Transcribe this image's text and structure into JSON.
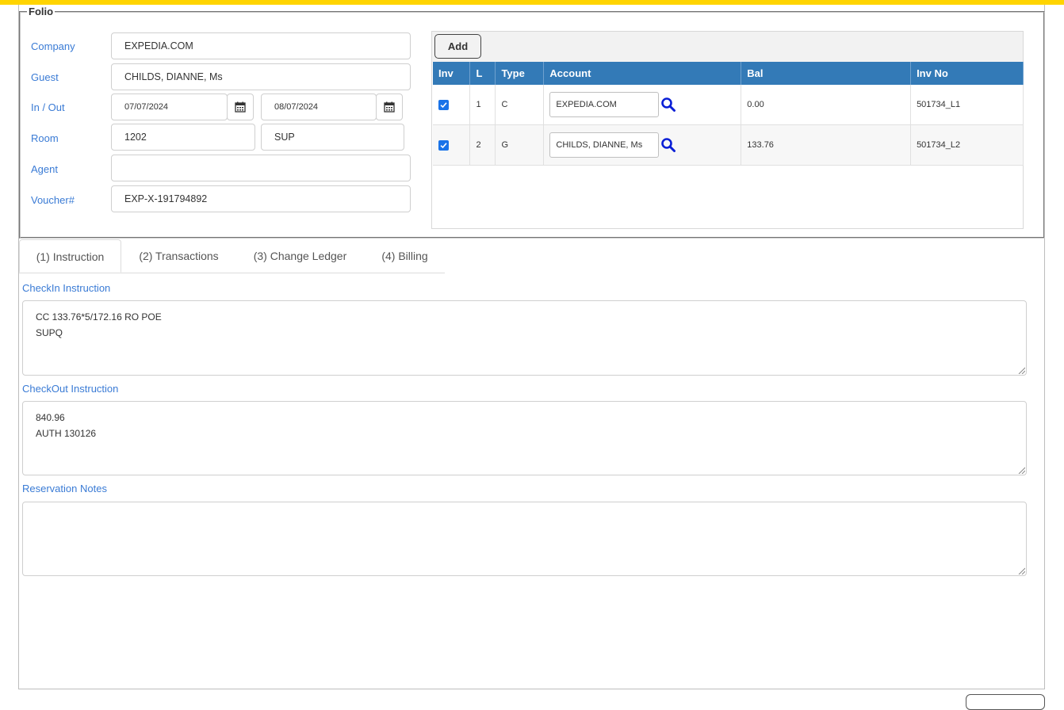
{
  "folio": {
    "legend": "Folio",
    "company_label": "Company",
    "company_value": "EXPEDIA.COM",
    "guest_label": "Guest",
    "guest_value": "CHILDS, DIANNE, Ms",
    "inout_label": "In / Out",
    "in_date": "07/07/2024",
    "out_date": "08/07/2024",
    "room_label": "Room",
    "room_value": "1202",
    "room_type": "SUP",
    "agent_label": "Agent",
    "agent_value": "",
    "voucher_label": "Voucher#",
    "voucher_value": "EXP-X-191794892"
  },
  "ledger": {
    "add_label": "Add",
    "columns": [
      "Inv",
      "L",
      "Type",
      "Account",
      "Bal",
      "Inv No"
    ],
    "rows": [
      {
        "inv_checked": true,
        "l": "1",
        "type": "C",
        "account": "EXPEDIA.COM",
        "bal": "0.00",
        "inv_no": "501734_L1"
      },
      {
        "inv_checked": true,
        "l": "2",
        "type": "G",
        "account": "CHILDS, DIANNE, Ms",
        "bal": "133.76",
        "inv_no": "501734_L2"
      }
    ]
  },
  "tabs": [
    {
      "label": "(1) Instruction",
      "active": true
    },
    {
      "label": "(2) Transactions",
      "active": false
    },
    {
      "label": "(3) Change Ledger",
      "active": false
    },
    {
      "label": "(4) Billing",
      "active": false
    }
  ],
  "instructions": {
    "checkin_label": "CheckIn Instruction",
    "checkin_lines": [
      "CC 133.76*5/172.16 RO POE",
      "SUPQ"
    ],
    "checkout_label": "CheckOut Instruction",
    "checkout_lines": [
      "840.96",
      "AUTH 130126"
    ],
    "notes_label": "Reservation Notes",
    "notes_lines": []
  },
  "colors": {
    "accent_yellow": "#ffd400",
    "label_blue": "#3a7bd5",
    "header_blue": "#337ab7",
    "search_icon": "#0a1fd6"
  }
}
